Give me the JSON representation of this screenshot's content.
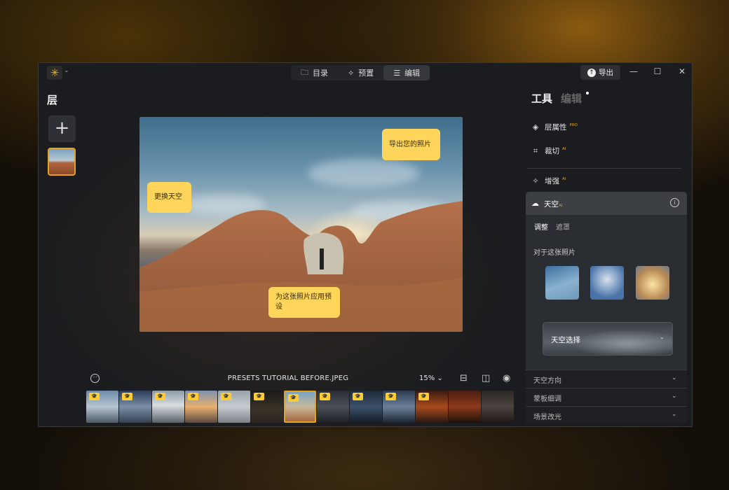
{
  "app": {
    "logo_glyph": "✳"
  },
  "nav": {
    "items": [
      {
        "icon": "🗀",
        "label": "目录"
      },
      {
        "icon": "✧",
        "label": "预置"
      },
      {
        "icon": "☰",
        "label": "编辑"
      }
    ]
  },
  "header": {
    "export_label": "导出",
    "export_icon": "↑"
  },
  "window_controls": {
    "minimize": "—",
    "maximize": "☐",
    "close": "✕"
  },
  "layers": {
    "title": "层",
    "add_label": "+"
  },
  "photo": {
    "callouts": {
      "replace_sky": "更换天空",
      "export_photo": "导出您的照片",
      "apply_preset": "为这张照片应用预设"
    }
  },
  "bottombar": {
    "more": "···",
    "filename": "PRESETS TUTORIAL BEFORE.JPEG",
    "zoom": "15%",
    "zoom_chevron": "⌄"
  },
  "filmstrip": {
    "badge": "🎓",
    "items": 13,
    "selected_index": 6
  },
  "panel": {
    "tools_label": "工具",
    "edit_label": "编辑",
    "tools": [
      {
        "icon": "◈",
        "label": "层属性",
        "tag": "PRO"
      },
      {
        "icon": "⌗",
        "label": "裁切",
        "tag": "AI"
      },
      {
        "icon": "✧",
        "label": "增强",
        "tag": "AI"
      }
    ],
    "sky": {
      "title": "天空",
      "tag": "AI",
      "info": "i",
      "subtabs": [
        "调整",
        "遮罩"
      ],
      "for_photo": "对于这张照片",
      "select_label": "天空选择",
      "chevron": "⌄"
    },
    "accordions": [
      "天空方向",
      "蒙板细调",
      "场景改光"
    ]
  },
  "colors": {
    "accent": "#e8a21a",
    "callout": "#ffd55c"
  }
}
